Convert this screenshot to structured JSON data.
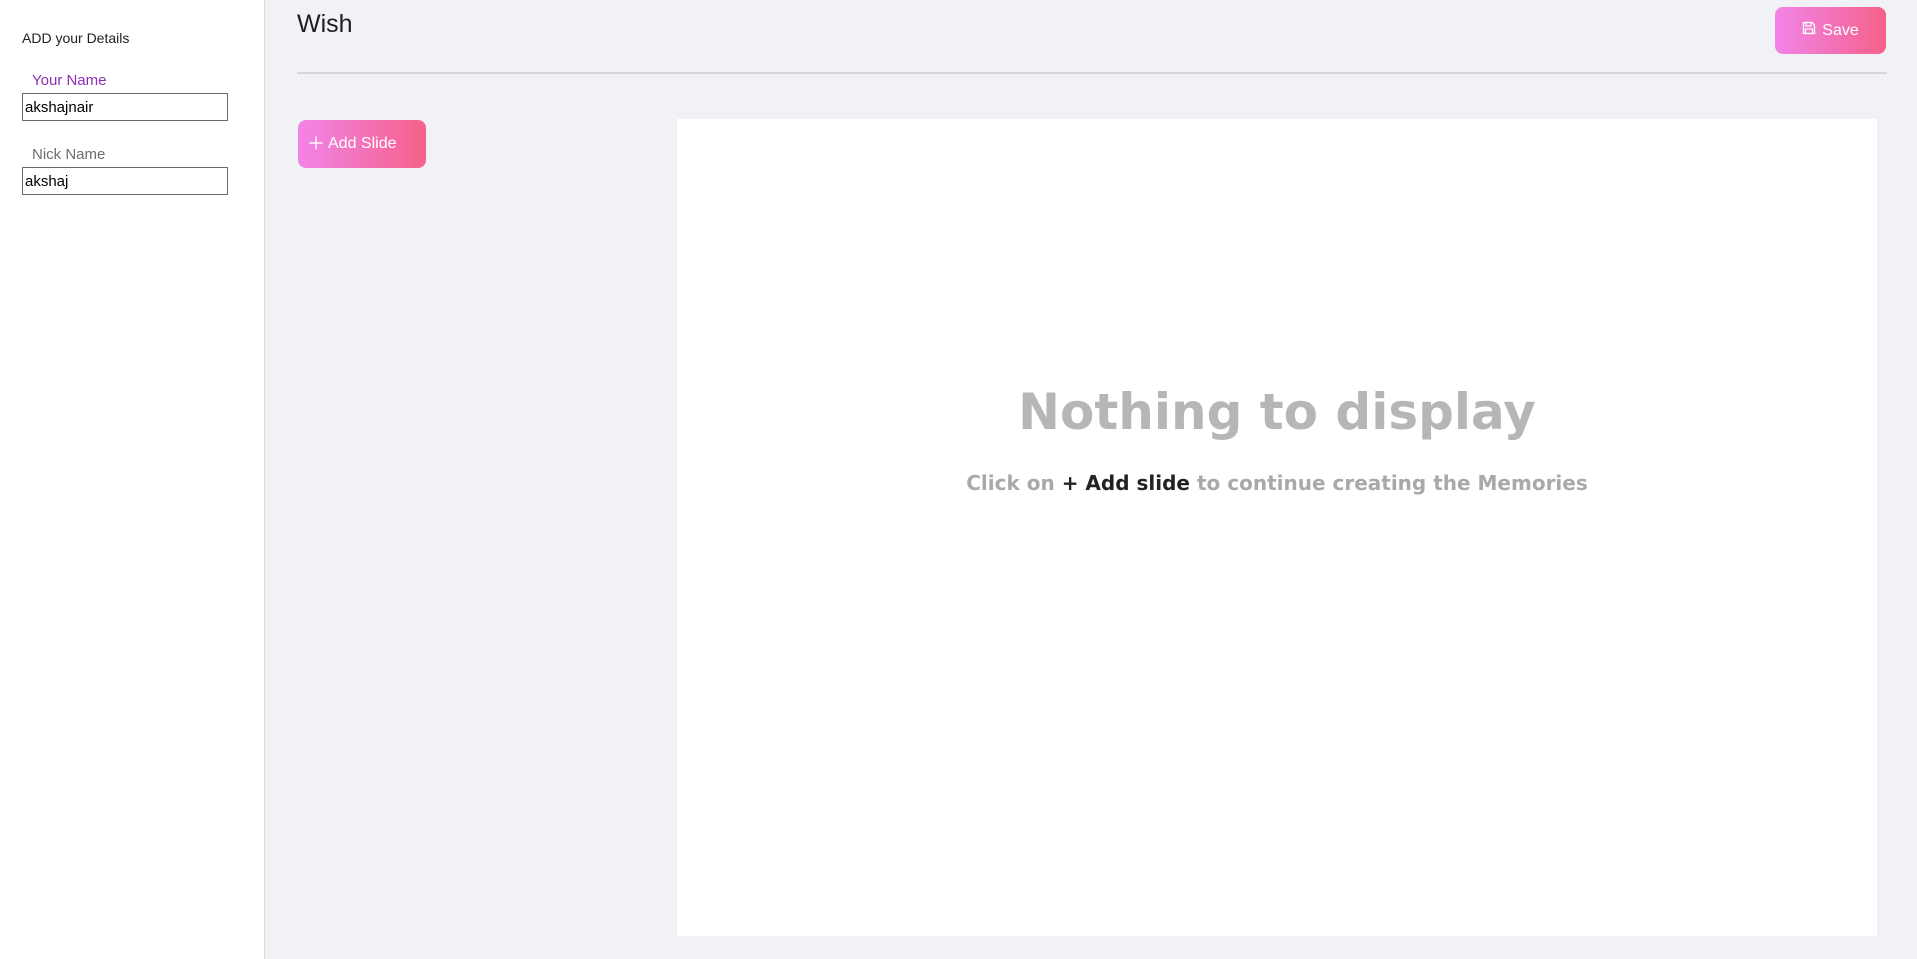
{
  "sidebar": {
    "title": "ADD your Details",
    "fields": [
      {
        "label": "Your Name",
        "value": "akshajnair"
      },
      {
        "label": "Nick Name",
        "value": "akshaj"
      }
    ]
  },
  "header": {
    "title": "Wish",
    "save_label": "Save",
    "save_icon": "floppy-disk-icon"
  },
  "toolbar": {
    "add_slide_label": "Add Slide",
    "add_slide_icon": "plus-icon"
  },
  "empty_state": {
    "title": "Nothing to display",
    "sub_prefix": "Click on",
    "sub_action": "+ Add slide",
    "sub_suffix": "to continue creating the Memories"
  },
  "colors": {
    "accent_gradient_start": "#f184e8",
    "accent_gradient_end": "#f4618a",
    "active_label": "#8a2fb0",
    "background": "#f1f2f6"
  }
}
